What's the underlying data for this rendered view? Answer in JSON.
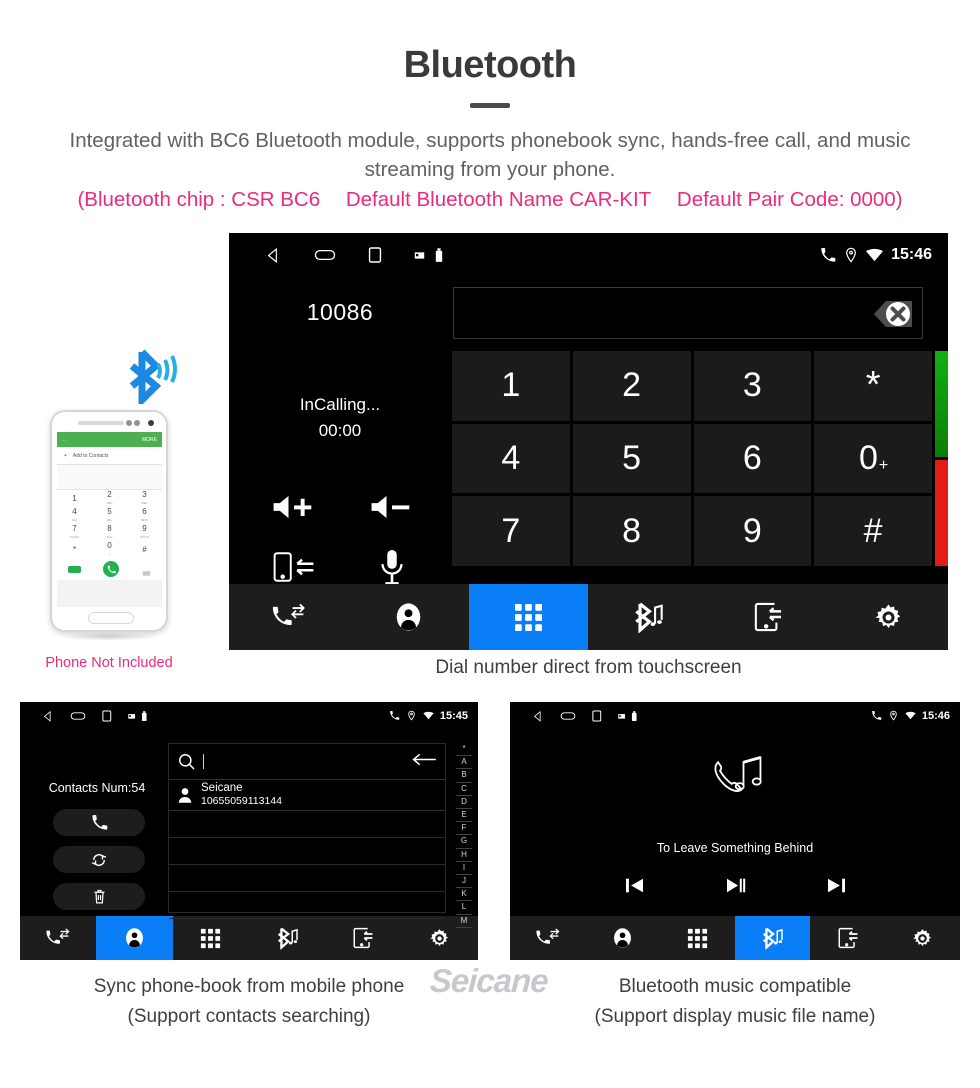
{
  "header": {
    "title": "Bluetooth",
    "subtitle": "Integrated with BC6 Bluetooth module, supports phonebook sync, hands-free call, and music streaming from your phone.",
    "spec_chip": "(Bluetooth chip : CSR BC6",
    "spec_name": "Default Bluetooth Name CAR-KIT",
    "spec_pair": "Default Pair Code: 0000)",
    "accent_pink": "#ed2a7b",
    "text_gray": "#616161"
  },
  "main_screenshot": {
    "caption": "Dial number direct from touchscreen",
    "statusbar": {
      "time": "15:46",
      "icons": [
        "back-triangle-icon",
        "home-oval-icon",
        "recents-square-icon",
        "sdcard-icon",
        "usb-icon",
        "phone-icon",
        "location-icon",
        "wifi-icon"
      ]
    },
    "dialer": {
      "number": "10086",
      "call_state": "InCalling...",
      "call_timer": "00:00",
      "input_value": "",
      "backspace_icon": "backspace-delete-icon",
      "controls": [
        {
          "name": "volume-up-button",
          "icon": "speaker-plus-icon"
        },
        {
          "name": "volume-down-button",
          "icon": "speaker-minus-icon"
        },
        {
          "name": "transfer-audio-button",
          "icon": "phone-transfer-icon"
        },
        {
          "name": "mute-mic-button",
          "icon": "microphone-icon"
        }
      ],
      "keys": [
        {
          "label": "1",
          "sup": ""
        },
        {
          "label": "2",
          "sup": ""
        },
        {
          "label": "3",
          "sup": ""
        },
        {
          "label": "*",
          "sup": ""
        },
        {
          "label": "4",
          "sup": ""
        },
        {
          "label": "5",
          "sup": ""
        },
        {
          "label": "6",
          "sup": ""
        },
        {
          "label": "0",
          "sup": "+"
        },
        {
          "label": "7",
          "sup": ""
        },
        {
          "label": "8",
          "sup": ""
        },
        {
          "label": "9",
          "sup": ""
        },
        {
          "label": "#",
          "sup": ""
        }
      ],
      "call_button_color": "#12b010",
      "hangup_button_color": "#e41b17"
    },
    "navbar": {
      "active_index": 2,
      "active_color": "#0a7ef7",
      "items": [
        {
          "name": "nav-call-log",
          "icon": "call-log-icon"
        },
        {
          "name": "nav-contacts",
          "icon": "contact-person-icon"
        },
        {
          "name": "nav-keypad",
          "icon": "keypad-grid-icon"
        },
        {
          "name": "nav-bt-music",
          "icon": "bluetooth-music-icon"
        },
        {
          "name": "nav-sync",
          "icon": "phone-sync-icon"
        },
        {
          "name": "nav-settings",
          "icon": "gear-icon"
        }
      ]
    }
  },
  "phone_mockup": {
    "note": "Phone Not Included",
    "note_color": "#ed2a7b",
    "bluetooth_icon": "bluetooth-signal-icon",
    "screen": {
      "topbar_back": "←",
      "topbar_more": "MORE",
      "add_contacts": "Add to Contacts",
      "keys": [
        {
          "digit": "1",
          "letters": ""
        },
        {
          "digit": "2",
          "letters": "ABC"
        },
        {
          "digit": "3",
          "letters": "DEF"
        },
        {
          "digit": "4",
          "letters": "GHI"
        },
        {
          "digit": "5",
          "letters": "JKL"
        },
        {
          "digit": "6",
          "letters": "MNO"
        },
        {
          "digit": "7",
          "letters": "PQRS"
        },
        {
          "digit": "8",
          "letters": "TUV"
        },
        {
          "digit": "9",
          "letters": "WXYZ"
        },
        {
          "digit": "*",
          "letters": ""
        },
        {
          "digit": "0",
          "letters": "+"
        },
        {
          "digit": "#",
          "letters": ""
        }
      ]
    }
  },
  "contacts_screenshot": {
    "caption_line1": "Sync phone-book from mobile phone",
    "caption_line2": "(Support contacts searching)",
    "statusbar": {
      "time": "15:45"
    },
    "contacts_count_label": "Contacts Num:54",
    "side_buttons": [
      {
        "name": "dial-contact-button",
        "icon": "phone-icon"
      },
      {
        "name": "sync-contacts-button",
        "icon": "refresh-sync-icon"
      },
      {
        "name": "delete-contacts-button",
        "icon": "trash-icon"
      }
    ],
    "search": {
      "icon": "search-icon",
      "value": "",
      "placeholder": "",
      "back_icon": "back-arrow-icon"
    },
    "contact_list": [
      {
        "name": "Seicane",
        "number": "10655059113144",
        "avatar": "person-avatar-icon"
      }
    ],
    "alpha_index": [
      "*",
      "A",
      "B",
      "C",
      "D",
      "E",
      "F",
      "G",
      "H",
      "I",
      "J",
      "K",
      "L",
      "M"
    ],
    "navbar": {
      "active_index": 1,
      "active_color": "#0a7ef7"
    }
  },
  "music_screenshot": {
    "caption_line1": "Bluetooth music compatible",
    "caption_line2": "(Support display music file name)",
    "statusbar": {
      "time": "15:46"
    },
    "album_icon": "phone-music-note-icon",
    "track_title": "To Leave Something Behind",
    "player_controls": [
      {
        "name": "previous-track-button",
        "icon": "skip-previous-icon"
      },
      {
        "name": "play-pause-button",
        "icon": "play-pause-icon"
      },
      {
        "name": "next-track-button",
        "icon": "skip-next-icon"
      }
    ],
    "navbar": {
      "active_index": 3,
      "active_color": "#0a7ef7"
    }
  },
  "watermark": {
    "text": "Seicane"
  }
}
